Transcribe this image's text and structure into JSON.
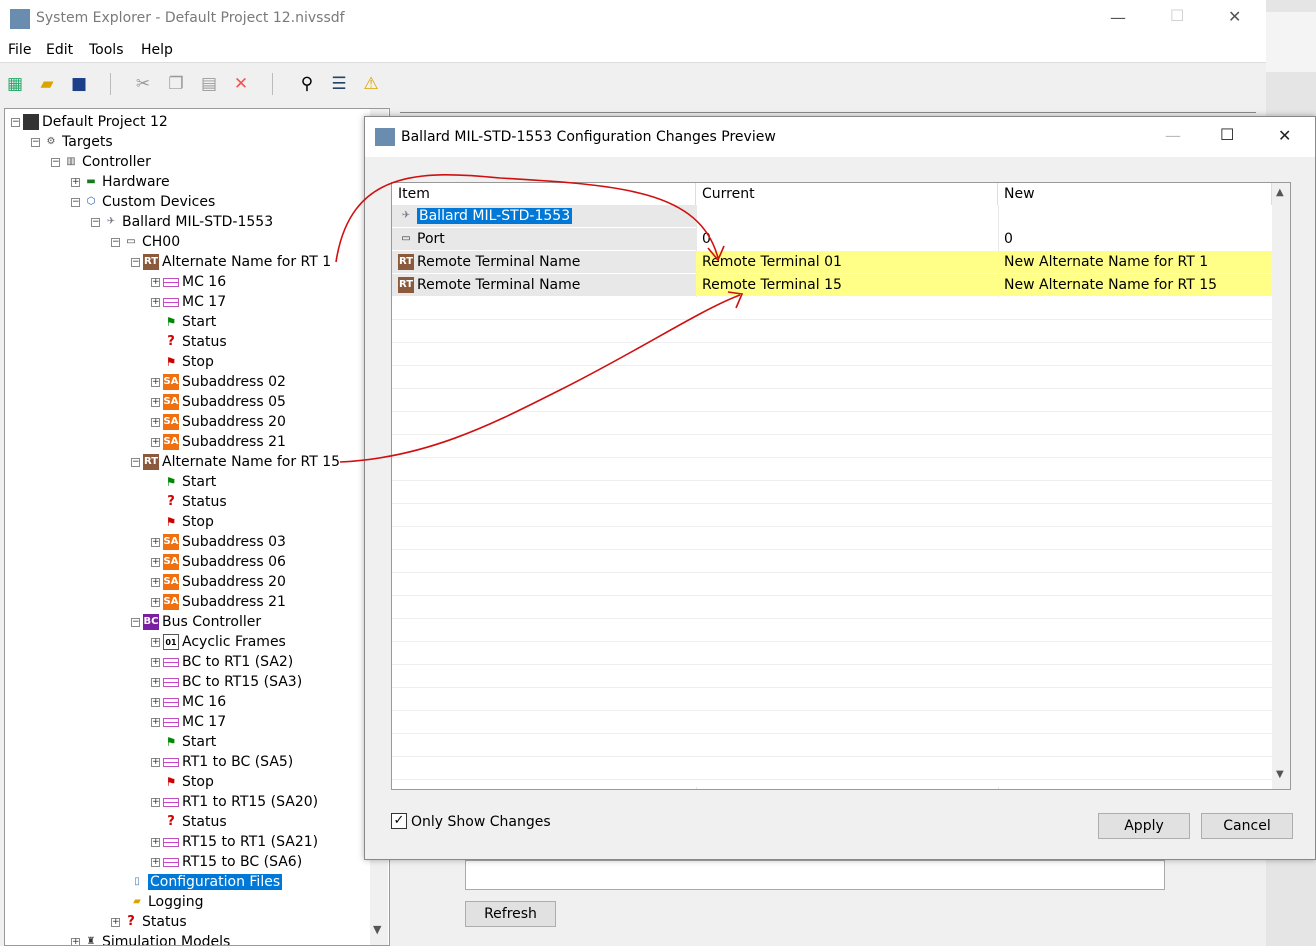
{
  "main": {
    "title": "System Explorer - Default Project 12.nivssdf"
  },
  "menu": [
    "File",
    "Edit",
    "Tools",
    "Help"
  ],
  "tree": [
    {
      "label": "Default Project 12"
    },
    {
      "label": "Targets"
    },
    {
      "label": "Controller"
    },
    {
      "label": "Hardware"
    },
    {
      "label": "Custom Devices"
    },
    {
      "label": "Ballard MIL-STD-1553"
    },
    {
      "label": "CH00"
    },
    {
      "label": "Alternate Name for RT 1"
    },
    {
      "label": "MC 16"
    },
    {
      "label": "MC 17"
    },
    {
      "label": "Start"
    },
    {
      "label": "Status"
    },
    {
      "label": "Stop"
    },
    {
      "label": "Subaddress 02"
    },
    {
      "label": "Subaddress 05"
    },
    {
      "label": "Subaddress 20"
    },
    {
      "label": "Subaddress 21"
    },
    {
      "label": "Alternate Name for RT 15"
    },
    {
      "label": "Start"
    },
    {
      "label": "Status"
    },
    {
      "label": "Stop"
    },
    {
      "label": "Subaddress 03"
    },
    {
      "label": "Subaddress 06"
    },
    {
      "label": "Subaddress 20"
    },
    {
      "label": "Subaddress 21"
    },
    {
      "label": "Bus Controller"
    },
    {
      "label": "Acyclic Frames"
    },
    {
      "label": "BC to RT1 (SA2)"
    },
    {
      "label": "BC to RT15 (SA3)"
    },
    {
      "label": "MC 16"
    },
    {
      "label": "MC 17"
    },
    {
      "label": "Start"
    },
    {
      "label": "RT1 to BC (SA5)"
    },
    {
      "label": "Stop"
    },
    {
      "label": "RT1 to RT15 (SA20)"
    },
    {
      "label": "Status"
    },
    {
      "label": "RT15 to RT1 (SA21)"
    },
    {
      "label": "RT15 to BC (SA6)"
    },
    {
      "label": "Configuration Files"
    },
    {
      "label": "Logging"
    },
    {
      "label": "Status"
    },
    {
      "label": "Simulation Models"
    }
  ],
  "icons": {
    "rt": "RT",
    "sa": "SA",
    "bc": "BC"
  },
  "dialog": {
    "title": "Ballard MIL-STD-1553 Configuration Changes Preview",
    "columns": [
      "Item",
      "Current",
      "New"
    ],
    "rows": [
      {
        "item": "Ballard MIL-STD-1553",
        "current": "",
        "new": ""
      },
      {
        "item": "Port",
        "current": "0",
        "new": "0"
      },
      {
        "item": "Remote Terminal Name",
        "current": "Remote Terminal 01",
        "new": "New Alternate Name for RT 1"
      },
      {
        "item": "Remote Terminal Name",
        "current": "Remote Terminal 15",
        "new": "New Alternate Name for RT 15"
      }
    ],
    "only_show_changes": "Only Show Changes",
    "apply": "Apply",
    "cancel": "Cancel"
  },
  "refresh": "Refresh"
}
